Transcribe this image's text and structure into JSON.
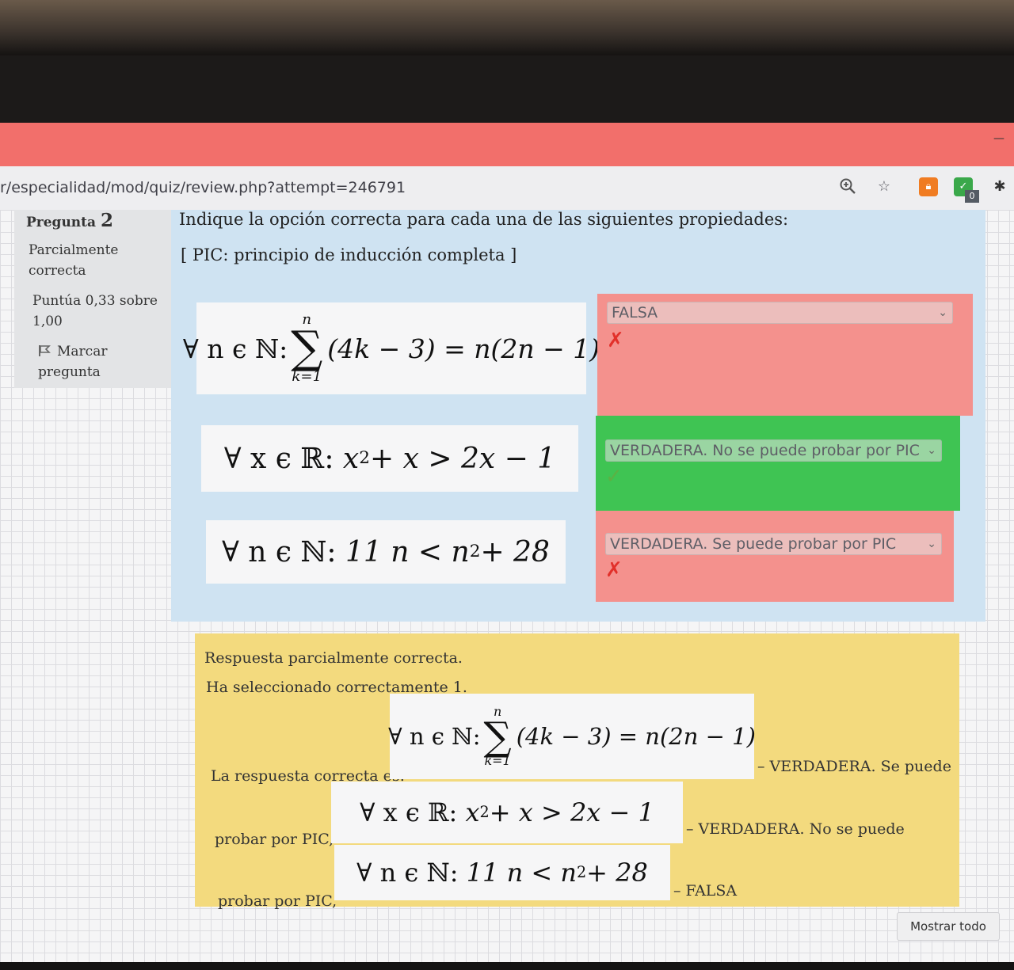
{
  "browser": {
    "url": "r/especialidad/mod/quiz/review.php?attempt=246791",
    "extension_badge": "0"
  },
  "info": {
    "question_label": "Pregunta",
    "question_number": "2",
    "state_line1": "Parcialmente",
    "state_line2": "correcta",
    "grade_line1": "Puntúa 0,33 sobre",
    "grade_line2": "1,00",
    "flag_line1": "Marcar",
    "flag_line2": "pregunta"
  },
  "question": {
    "text": "Indique la opción correcta para cada una de las siguientes propiedades:",
    "note": "[ PIC: principio de inducción completa ]",
    "items": [
      {
        "prefix": "∀ n ϵ ℕ:",
        "sum_upper": "n",
        "sum_lower": "k=1",
        "expr": "(4k − 3) = n(2n − 1)",
        "selected": "FALSA",
        "result": "incorrect"
      },
      {
        "prefix": "∀ x ϵ ℝ:",
        "expr_a": "x",
        "exp": "2",
        "expr_b": " + x > 2x − 1",
        "selected": "VERDADERA. No se puede probar por PIC",
        "result": "correct"
      },
      {
        "prefix": "∀ n ϵ ℕ:",
        "expr_a": "11 n < n",
        "exp": "2",
        "expr_b": " + 28",
        "selected": "VERDADERA. Se puede probar por PIC",
        "result": "incorrect"
      }
    ]
  },
  "feedback": {
    "partial": "Respuesta parcialmente correcta.",
    "selected_count": "Ha seleccionado correctamente 1.",
    "correct_is": "La respuesta correcta es:",
    "ans1": "– VERDADERA. Se puede",
    "ans1_cont": "probar por PIC,",
    "ans2": "– VERDADERA. No se puede",
    "ans2_cont": "probar por PIC,",
    "ans3": "– FALSA"
  },
  "buttons": {
    "show_all": "Mostrar todo"
  },
  "colors": {
    "browser_tab": "#f26f6b",
    "formulation_bg": "#cfe3f2",
    "incorrect_bg": "#f4918d",
    "correct_bg": "#3fc453",
    "feedback_bg": "#f3da7e"
  },
  "icons": {
    "zoom": "zoom-icon",
    "star": "bookmark-star-icon",
    "ext1": "extension-lock-icon",
    "ext2": "extension-check-icon",
    "puzzle": "extensions-puzzle-icon",
    "flag": "flag-icon",
    "wrong": "cross-icon",
    "right": "check-icon"
  }
}
